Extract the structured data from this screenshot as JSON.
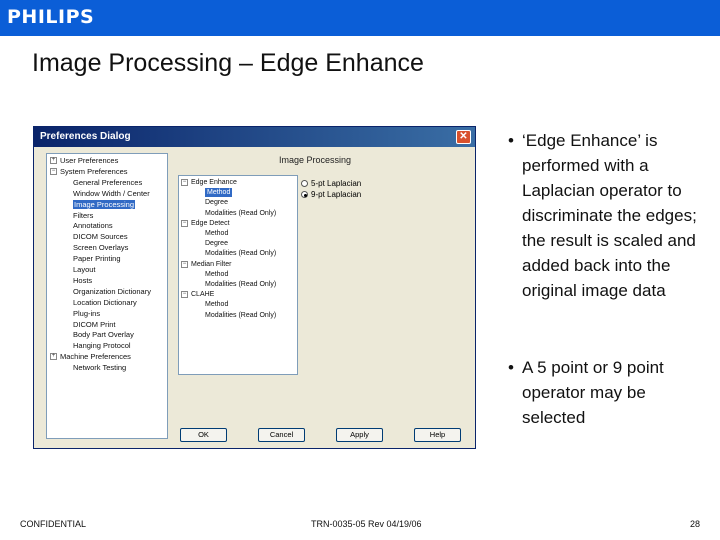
{
  "brand": {
    "logo_text": "PHILIPS",
    "accent": "#0b5ed7"
  },
  "slide": {
    "title": "Image Processing – Edge Enhance"
  },
  "dialog": {
    "title": "Preferences Dialog",
    "close_glyph": "✕",
    "tree": [
      {
        "label": "User Preferences",
        "expander": "+"
      },
      {
        "label": "System Preferences",
        "expander": "−"
      },
      {
        "label": "General Preferences"
      },
      {
        "label": "Window Width / Center"
      },
      {
        "label": "Image Processing",
        "selected": true
      },
      {
        "label": "Filters"
      },
      {
        "label": "Annotations"
      },
      {
        "label": "DICOM Sources"
      },
      {
        "label": "Screen Overlays"
      },
      {
        "label": "Paper Printing"
      },
      {
        "label": "Layout"
      },
      {
        "label": "Hosts"
      },
      {
        "label": "Organization Dictionary"
      },
      {
        "label": "Location Dictionary"
      },
      {
        "label": "Plug-ins"
      },
      {
        "label": "DICOM Print"
      },
      {
        "label": "Body Part Overlay"
      },
      {
        "label": "Hanging Protocol"
      },
      {
        "label": "Machine Preferences",
        "expander": "+"
      },
      {
        "label": "Network Testing"
      }
    ],
    "pane_title": "Image Processing",
    "sub_tree": [
      {
        "label": "Edge Enhance",
        "expander": "−"
      },
      {
        "label": "Method",
        "selected": true
      },
      {
        "label": "Degree"
      },
      {
        "label": "Modalities (Read Only)"
      },
      {
        "label": "Edge Detect",
        "expander": "−"
      },
      {
        "label": "Method"
      },
      {
        "label": "Degree"
      },
      {
        "label": "Modalities (Read Only)"
      },
      {
        "label": "Median Filter",
        "expander": "−"
      },
      {
        "label": "Method"
      },
      {
        "label": "Modalities (Read Only)"
      },
      {
        "label": "CLAHE",
        "expander": "−"
      },
      {
        "label": "Method"
      },
      {
        "label": "Modalities (Read Only)"
      }
    ],
    "options": [
      {
        "label": "5-pt Laplacian",
        "checked": false
      },
      {
        "label": "9-pt Laplacian",
        "checked": true
      }
    ],
    "buttons": {
      "ok": "OK",
      "cancel": "Cancel",
      "apply": "Apply",
      "help": "Help"
    }
  },
  "bullets": [
    "‘Edge Enhance’ is performed with a Laplacian operator to discriminate the edges; the result is scaled and added back into the original image data",
    "A 5 point or 9 point operator may be selected"
  ],
  "bullet_glyph": "•",
  "footer": {
    "left": "CONFIDENTIAL",
    "center": "TRN-0035-05 Rev 04/19/06",
    "page": "28"
  }
}
